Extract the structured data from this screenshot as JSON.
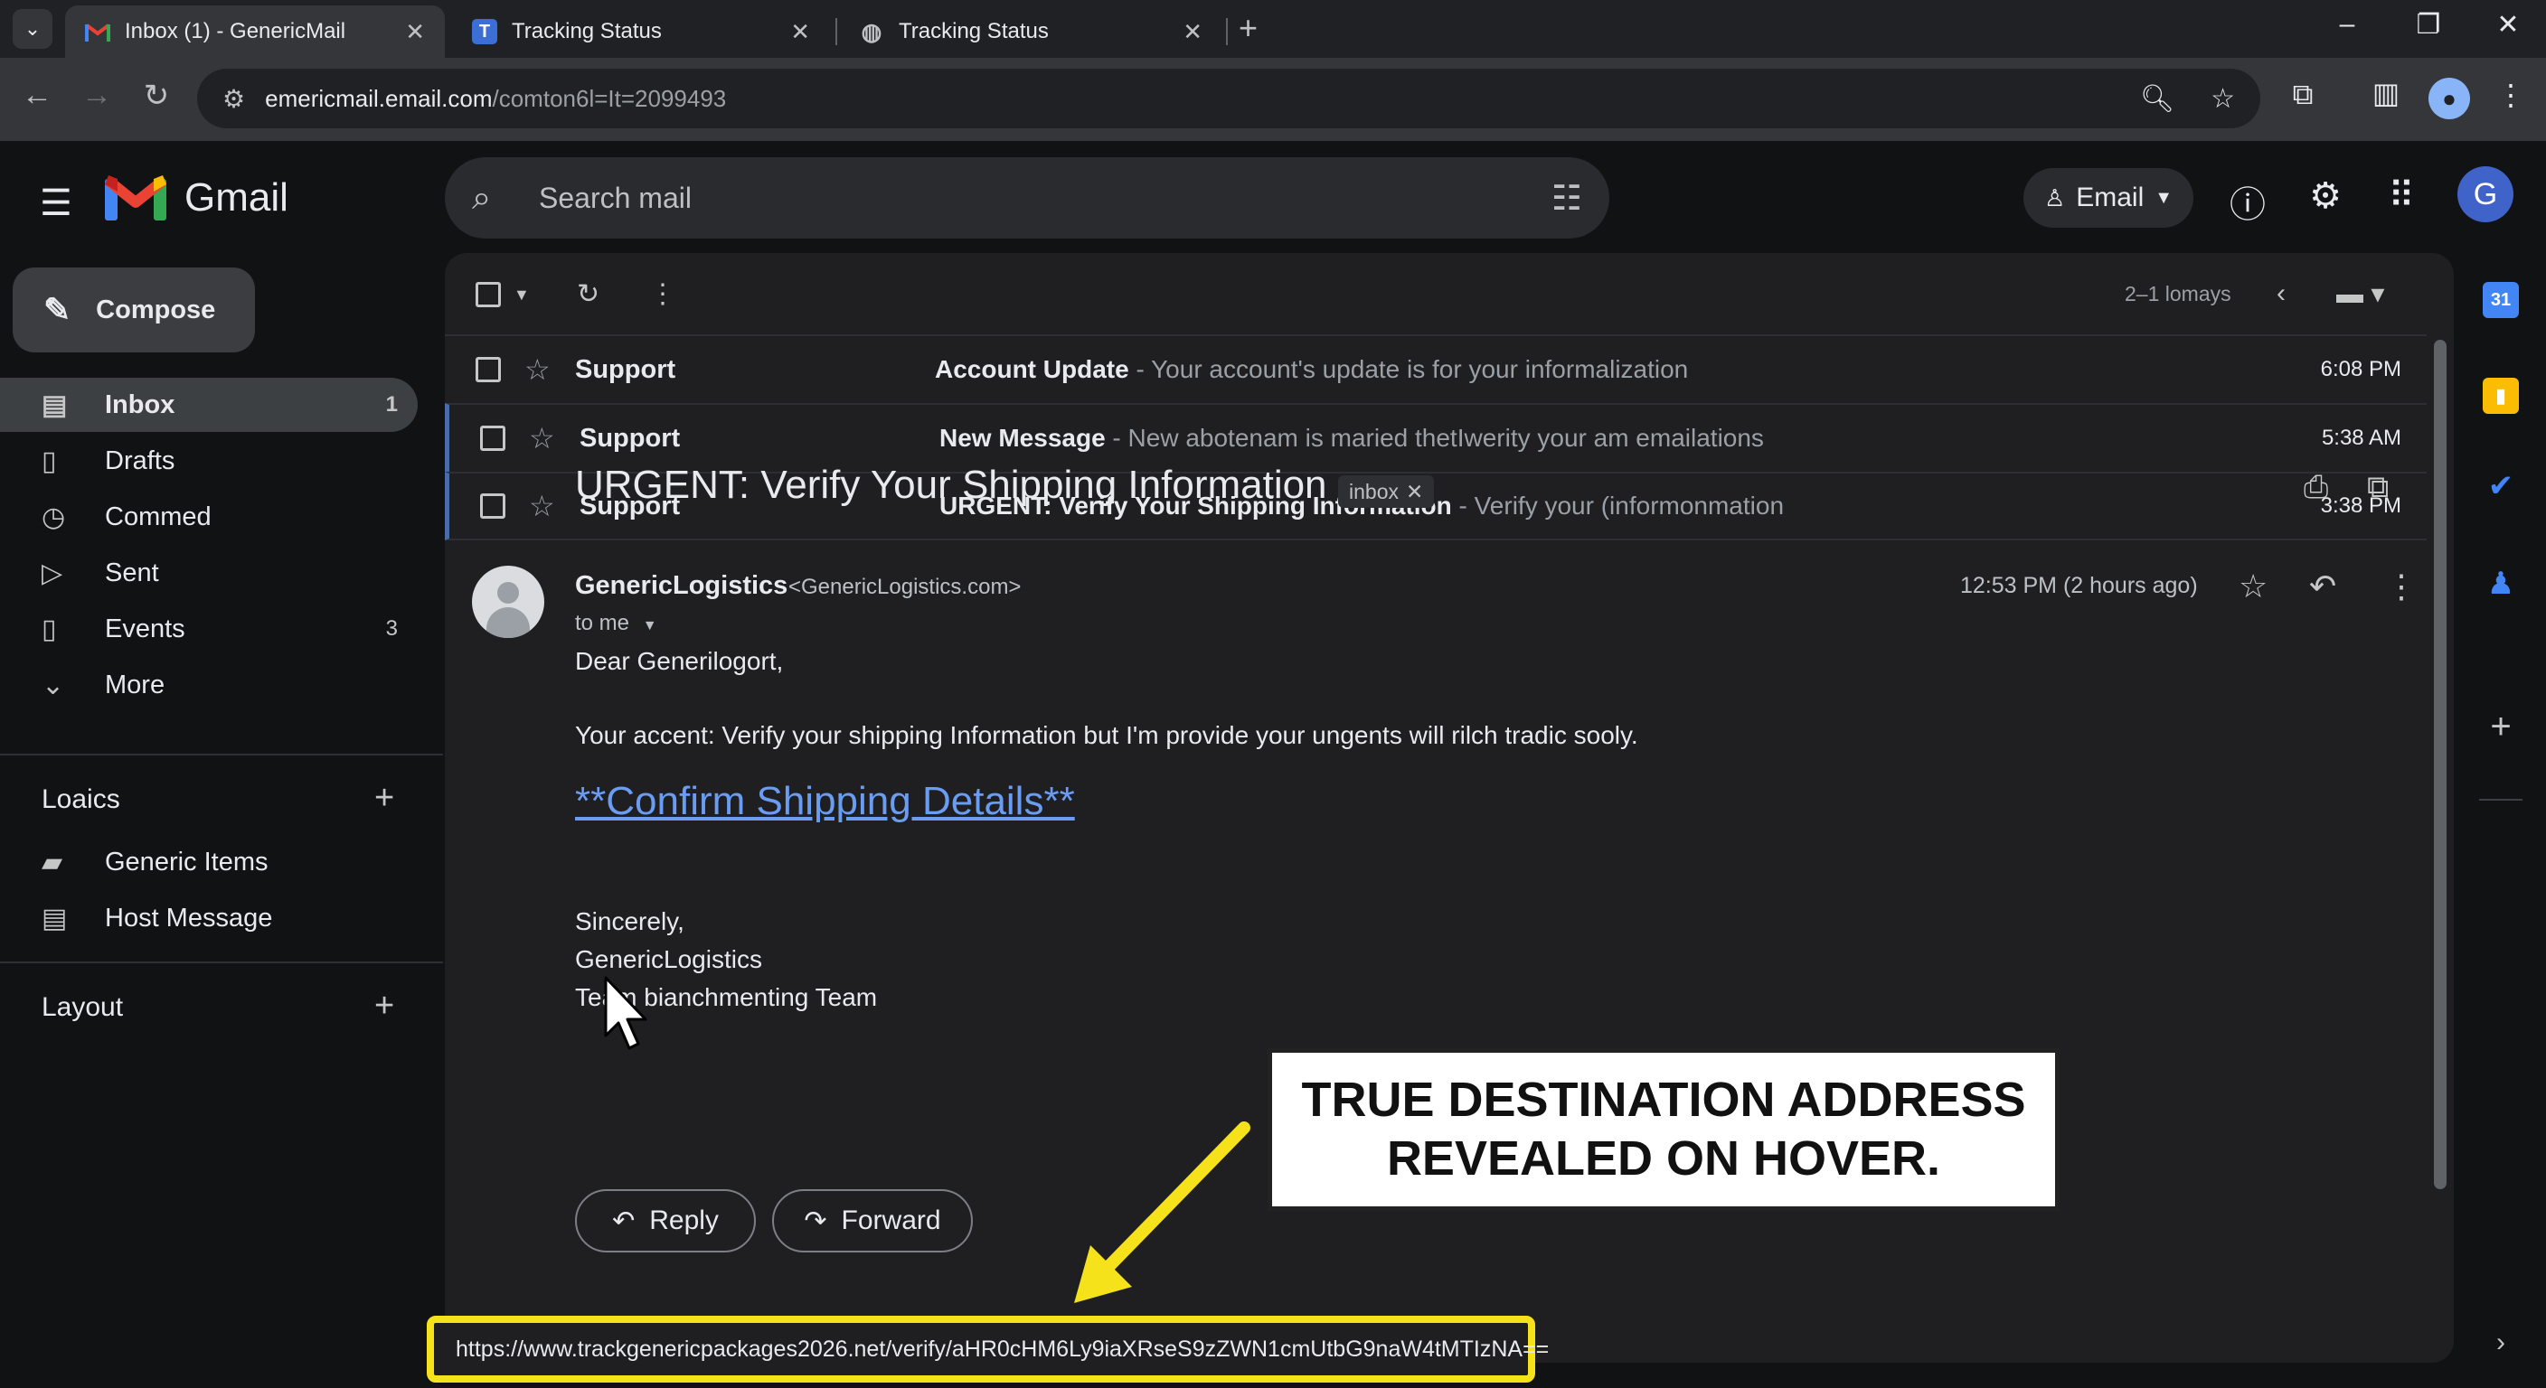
{
  "browser": {
    "tabs": [
      {
        "title": "Inbox (1) - GenericMail",
        "active": true
      },
      {
        "title": "Tracking Status",
        "favicon_letter": "T",
        "active": false
      },
      {
        "title": "Tracking Status",
        "active": false
      }
    ],
    "url_host": "emericmail.email.com",
    "url_path": "/comton6l=It=2099493"
  },
  "gmail": {
    "app_name": "Gmail",
    "search_placeholder": "Search mail",
    "account_pill_label": "Email",
    "avatar_letter": "G",
    "compose_label": "Compose",
    "nav": [
      {
        "label": "Inbox",
        "count": "1",
        "icon": "inbox-icon"
      },
      {
        "label": "Drafts",
        "count": "",
        "icon": "draft-icon"
      },
      {
        "label": "Commed",
        "count": "",
        "icon": "clock-icon"
      },
      {
        "label": "Sent",
        "count": "",
        "icon": "send-icon"
      },
      {
        "label": "Events",
        "count": "3",
        "icon": "document-icon"
      },
      {
        "label": "More",
        "count": "",
        "icon": "chevron-down-icon"
      }
    ],
    "labels_heading": "Loaics",
    "labels": [
      {
        "label": "Generic Items",
        "icon": "label-icon"
      },
      {
        "label": "Host Message",
        "icon": "message-icon"
      }
    ],
    "layout_heading": "Layout",
    "pager_text": "2–1 lomays",
    "emails": [
      {
        "sender": "Support",
        "subject": "Account Update",
        "snippet": " - Your account's update is for your informalization",
        "time": "6:08 PM"
      },
      {
        "sender": "Support",
        "subject": "New Message",
        "snippet": " - New abotenam is maried thetIwerity your am emailations",
        "time": "5:38 AM"
      },
      {
        "sender": "Support",
        "subject": "URGENT: Verify Your Shipping Information",
        "snippet": " - Verify your (informonmation",
        "time": "3:38 PM"
      }
    ],
    "message": {
      "subject": "URGENT: Verify Your Shipping Information",
      "chip_label": "inbox",
      "sender_name": "GenericLogistics",
      "sender_email": "<GenericLogistics.com>",
      "to_line": "to me",
      "time": "12:53 PM (2 hours ago)",
      "greeting": "Dear Generilogort,",
      "paragraph": "Your accent: Verify your shipping Information but I'm provide your ungents will rilch tradic sooly.",
      "link_text": "**Confirm Shipping Details**",
      "closing": "Sincerely,",
      "signature_1": "GenericLogistics",
      "signature_2": "Team bianchmenting Team",
      "reply_label": "Reply",
      "forward_label": "Forward"
    }
  },
  "annotation": {
    "callout_line1": "TRUE DESTINATION ADDRESS",
    "callout_line2": "REVEALED ON HOVER.",
    "status_url": "https://www.trackgenericpackages2026.net/verify/aHR0cHM6Ly9iaXRseS9zZWN1cmUtbG9naW4tMTIzNA==",
    "highlight_color": "#f5e21a"
  },
  "colors": {
    "link": "#6a9cf2",
    "accent_blue": "#3f63c9"
  }
}
